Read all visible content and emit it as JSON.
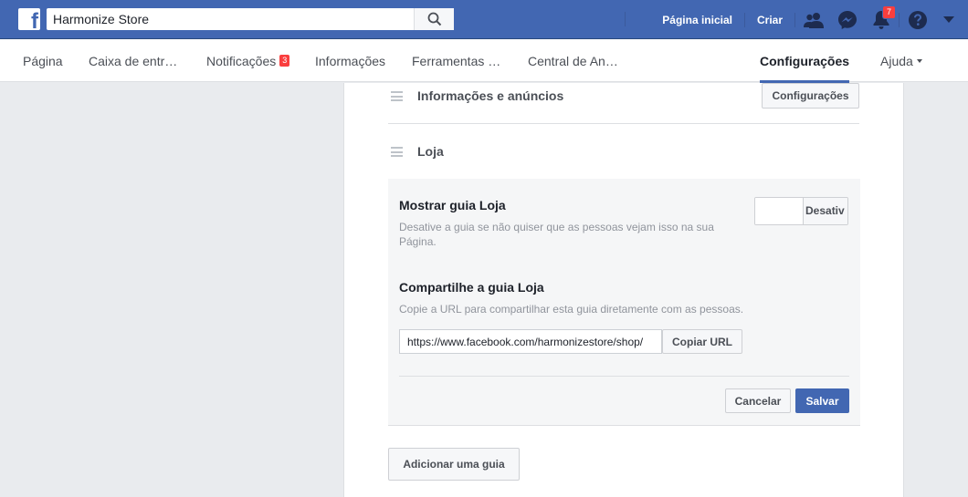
{
  "topbar": {
    "logo_letter": "f",
    "search_value": "Harmonize Store",
    "home_label": "Página inicial",
    "create_label": "Criar",
    "notifications_count": "7",
    "colors": {
      "bar": "#4267b2",
      "badge": "#fa3e3e"
    },
    "icons": [
      "search-icon",
      "friends-icon",
      "messenger-icon",
      "bell-icon",
      "help-icon",
      "caret-down-icon"
    ]
  },
  "tabs": {
    "page": "Página",
    "inbox": "Caixa de entr…",
    "notifications": "Notificações",
    "notifications_badge": "3",
    "insights": "Informações",
    "tools": "Ferramentas …",
    "ads": "Central de An…",
    "settings": "Configurações",
    "help": "Ajuda"
  },
  "panel": {
    "info_ads_title": "Informações e anúncios",
    "settings_button": "Configurações",
    "shop_title": "Loja",
    "show_tab_title": "Mostrar guia Loja",
    "show_tab_desc": "Desative a guia se não quiser que as pessoas vejam isso na sua Página.",
    "toggle_label": "Desativ",
    "share_title": "Compartilhe a guia Loja",
    "share_desc": "Copie a URL para compartilhar esta guia diretamente com as pessoas.",
    "url_value": "https://www.facebook.com/harmonizestore/shop/",
    "copy_url_button": "Copiar URL",
    "cancel_button": "Cancelar",
    "save_button": "Salvar",
    "add_tab_button": "Adicionar uma guia"
  }
}
